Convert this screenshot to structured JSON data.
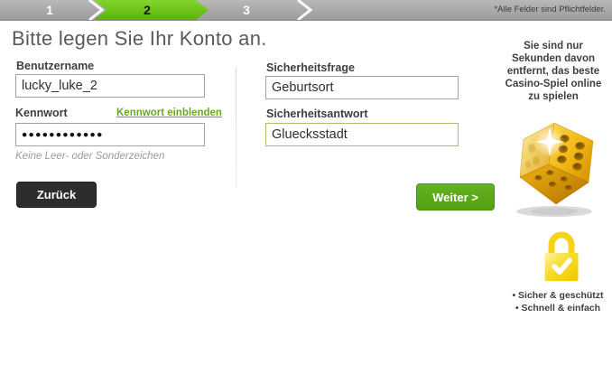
{
  "stepper": {
    "steps": [
      {
        "label": "1"
      },
      {
        "label": "2"
      },
      {
        "label": "3"
      }
    ],
    "active_step": "2",
    "note": "*Alle Felder sind Pflichtfelder."
  },
  "page": {
    "title": "Bitte legen Sie Ihr Konto an."
  },
  "form": {
    "username": {
      "label": "Benutzername",
      "value": "lucky_luke_2"
    },
    "password": {
      "label": "Kennwort",
      "masked_value": "●●●●●●●●●●●●",
      "show_link": "Kennwort einblenden",
      "hint": "Keine Leer- oder Sonderzeichen"
    },
    "security_question": {
      "label": "Sicherheitsfrage",
      "value": "Geburtsort"
    },
    "security_answer": {
      "label": "Sicherheitsantwort",
      "value": "Gluecksstadt"
    },
    "back_button": "Zurück",
    "next_button": "Weiter >"
  },
  "sidebar": {
    "promo_lines": [
      "Sie sind nur",
      "Sekunden davon",
      "entfernt, das beste",
      "Casino-Spiel online",
      "zu spielen"
    ],
    "dice_icon": "golden-dice",
    "lock_icon": "gold-padlock-check",
    "bullets": [
      "• Sicher & geschützt",
      "• Schnell & einfach"
    ]
  },
  "colors": {
    "step_green": "#6fc61b",
    "button_green": "#58a716",
    "link_green": "#69a823",
    "gold": "#f2c400",
    "dark_button": "#2d2d2d"
  }
}
